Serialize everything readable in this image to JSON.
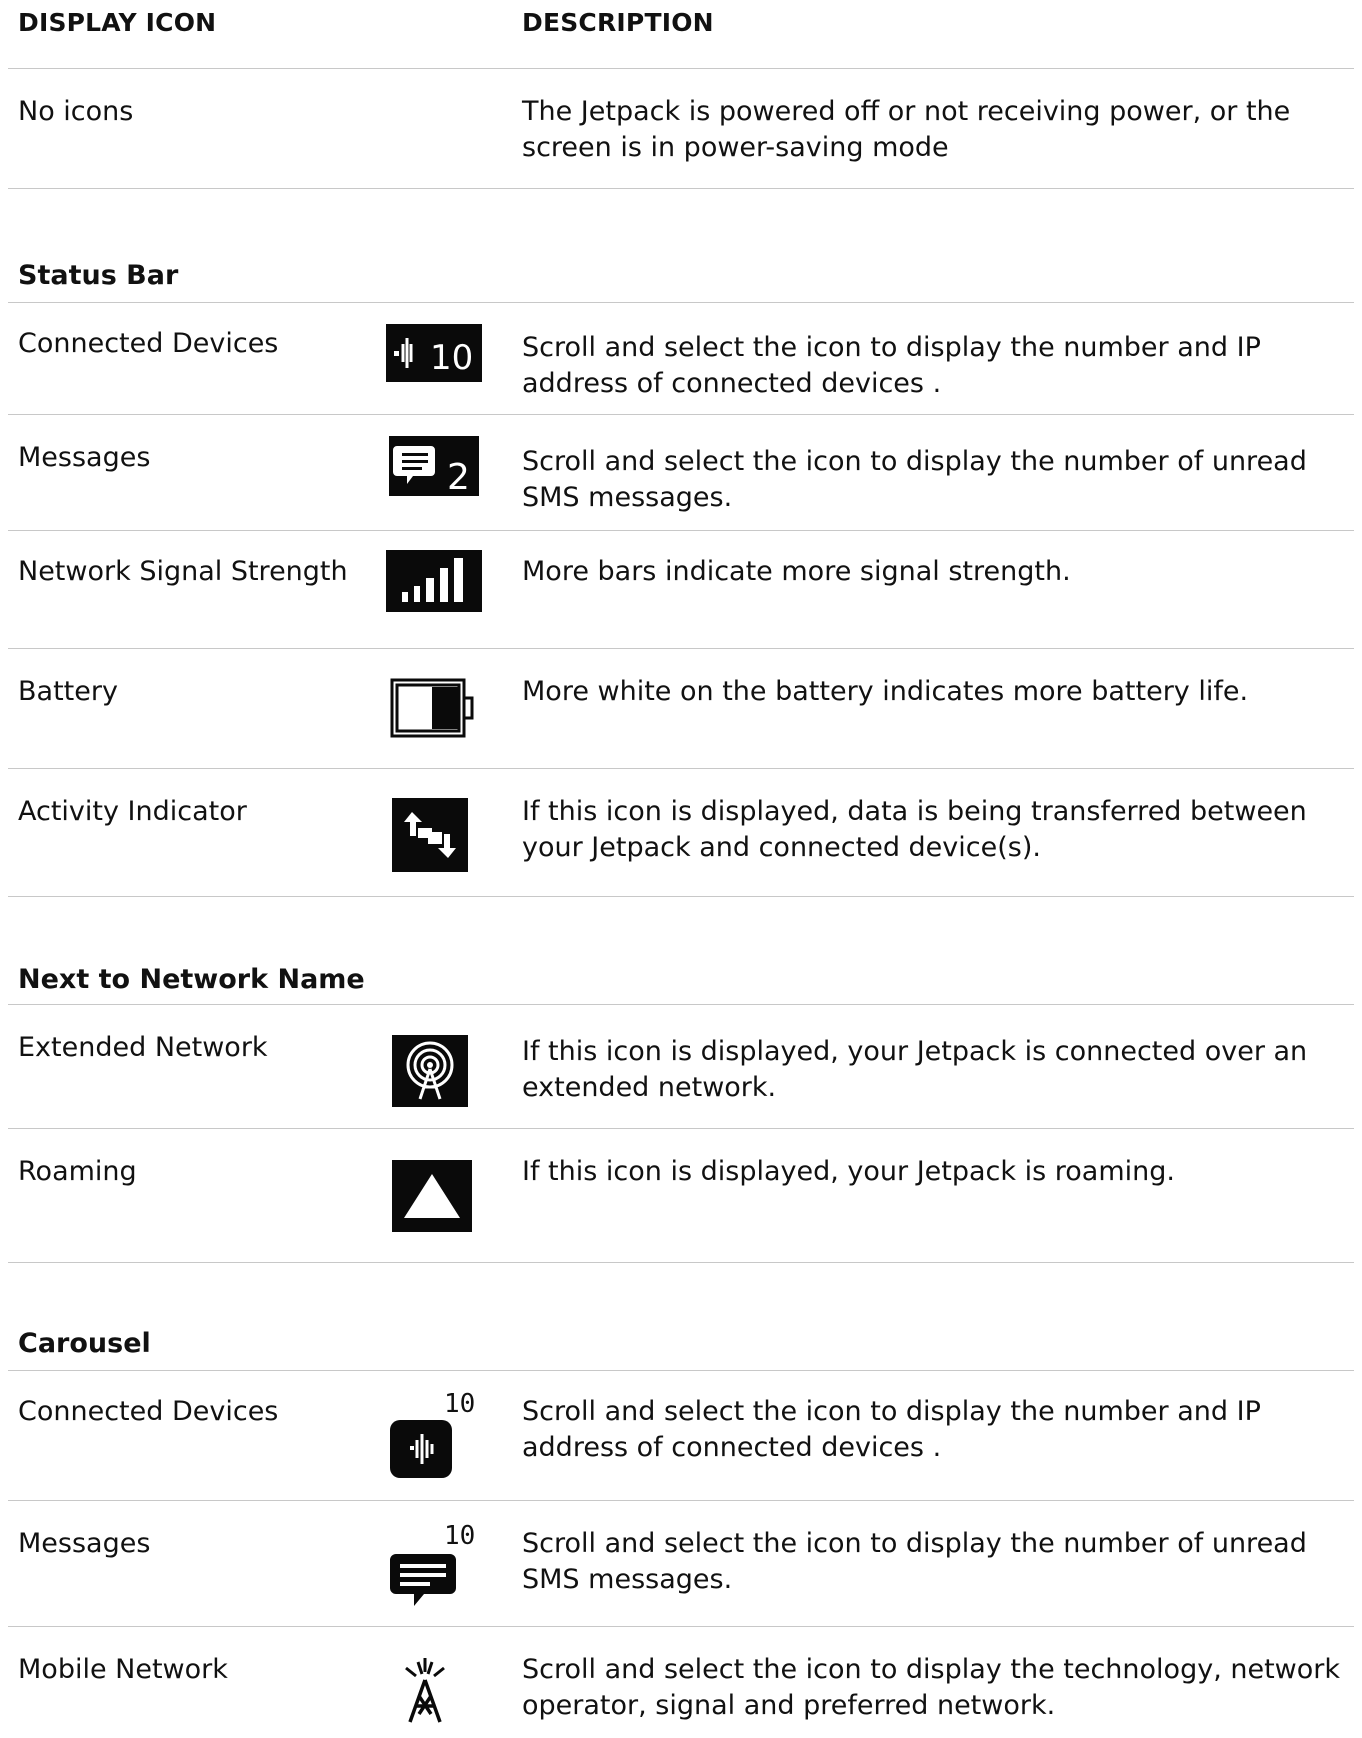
{
  "headers": {
    "display_icon": "DISPLAY ICON",
    "description": "DESCRIPTION"
  },
  "rows": {
    "no_icons": {
      "name": "No icons",
      "desc": "The Jetpack is powered off or not receiving power, or the screen is in power-saving mode"
    }
  },
  "status_bar": {
    "title": "Status Bar",
    "items": [
      {
        "name": "Connected Devices",
        "desc": "Scroll and select the icon to display the number and IP address of connected devices .",
        "icon": "connected-devices-icon",
        "badge": "10"
      },
      {
        "name": "Messages",
        "desc": "Scroll and select the icon to display the  number of unread SMS messages.",
        "icon": "message-icon",
        "badge": "2"
      },
      {
        "name": "Network Signal Strength",
        "desc": "More bars indicate more signal strength.",
        "icon": "signal-strength-icon"
      },
      {
        "name": "Battery",
        "desc": "More white on the battery indicates more battery life.",
        "icon": "battery-icon"
      },
      {
        "name": "Activity Indicator",
        "desc": "If this icon is displayed, data is being transferred between your Jetpack and connected device(s).",
        "icon": "activity-indicator-icon"
      }
    ]
  },
  "network_name": {
    "title": "Next to Network Name",
    "items": [
      {
        "name": "Extended Network",
        "desc": "If this icon is displayed, your Jetpack is connected over an extended network.",
        "icon": "extended-network-icon"
      },
      {
        "name": "Roaming",
        "desc": "If this icon is displayed, your Jetpack is roaming.",
        "icon": "roaming-icon"
      }
    ]
  },
  "carousel": {
    "title": "Carousel",
    "items": [
      {
        "name": "Connected Devices",
        "desc": "Scroll and select the icon to display the number and IP address of connected devices .",
        "icon": "connected-devices-icon",
        "badge": "10"
      },
      {
        "name": "Messages",
        "desc": "Scroll and select the icon to display the  number of unread SMS messages.",
        "icon": "message-icon",
        "badge": "10"
      },
      {
        "name": "Mobile Network",
        "desc": "Scroll and select the icon to display the  technology, network operator, signal and preferred network.",
        "icon": "mobile-network-icon"
      }
    ]
  },
  "colors": {
    "rule": "#c8c8c8",
    "icon_bg": "#0a0a0a"
  }
}
